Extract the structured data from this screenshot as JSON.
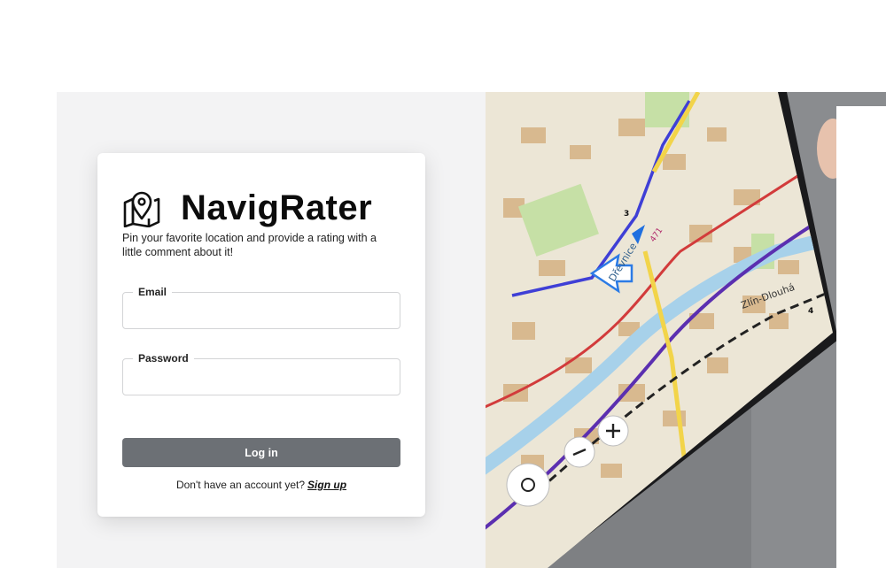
{
  "brand": {
    "name": "NavigRater",
    "icon": "map-pin-icon",
    "tagline": "Pin your favorite location and provide a rating with a little comment about it!"
  },
  "form": {
    "email": {
      "label": "Email",
      "value": "",
      "placeholder": ""
    },
    "password": {
      "label": "Password",
      "value": "",
      "placeholder": ""
    },
    "login_label": "Log in"
  },
  "signup": {
    "prompt": "Don't have an account yet?",
    "link_label": "Sign up"
  },
  "map": {
    "labels": [
      "Dřevnice",
      "Zlín-Dlouhá",
      "471",
      "3",
      "4"
    ],
    "zoom_in_icon": "plus-icon",
    "zoom_out_icon": "minus-icon",
    "locate_icon": "locate-icon"
  }
}
